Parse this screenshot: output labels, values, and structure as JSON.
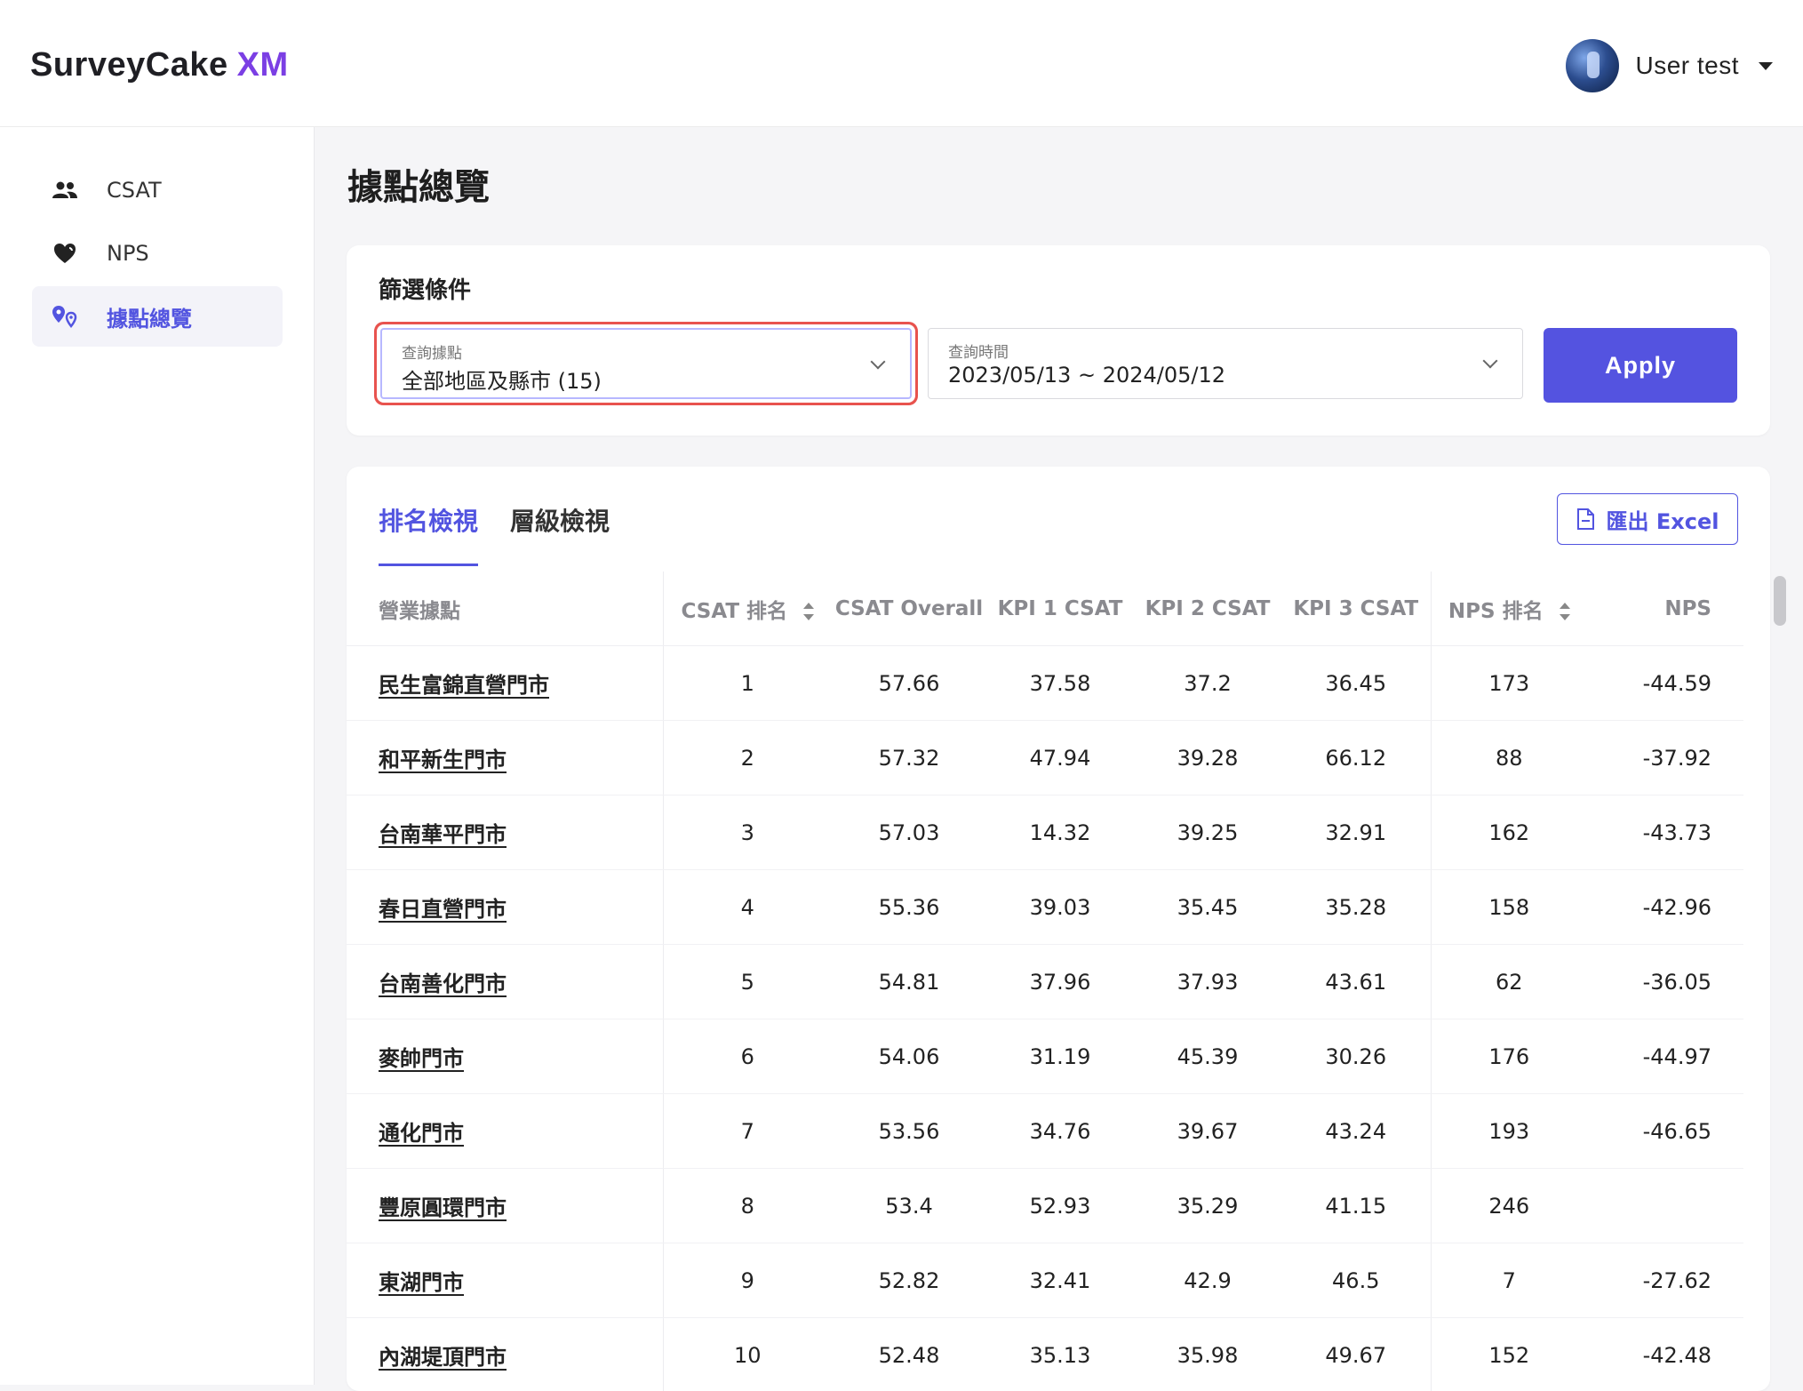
{
  "app": {
    "logo_main": "SurveyCake",
    "logo_suffix": "XM",
    "user_name": "User test"
  },
  "sidebar": {
    "items": [
      {
        "label": "CSAT",
        "icon": "people-icon",
        "active": false
      },
      {
        "label": "NPS",
        "icon": "heart-icon",
        "active": false
      },
      {
        "label": "據點總覽",
        "icon": "location-pin-icon",
        "active": true
      }
    ]
  },
  "page": {
    "title": "據點總覽"
  },
  "filters": {
    "title": "篩選條件",
    "location": {
      "label": "查詢據點",
      "value": "全部地區及縣市 (15)"
    },
    "period": {
      "label": "查詢時間",
      "value": "2023/05/13 ~ 2024/05/12"
    },
    "apply_label": "Apply"
  },
  "tabs": [
    {
      "label": "排名檢視",
      "active": true
    },
    {
      "label": "層級檢視",
      "active": false
    }
  ],
  "export_label": "匯出 Excel",
  "table": {
    "headers": {
      "name": "營業據點",
      "csat_rank": "CSAT 排名",
      "csat_overall": "CSAT Overall",
      "kpi1": "KPI 1 CSAT",
      "kpi2": "KPI 2 CSAT",
      "kpi3": "KPI 3 CSAT",
      "nps_rank": "NPS 排名",
      "nps": "NPS"
    },
    "rows": [
      {
        "name": "民生富錦直營門市",
        "csat_rank": "1",
        "csat_overall": "57.66",
        "kpi1": "37.58",
        "kpi2": "37.2",
        "kpi3": "36.45",
        "nps_rank": "173",
        "nps": "-44.59"
      },
      {
        "name": "和平新生門市",
        "csat_rank": "2",
        "csat_overall": "57.32",
        "kpi1": "47.94",
        "kpi2": "39.28",
        "kpi3": "66.12",
        "nps_rank": "88",
        "nps": "-37.92"
      },
      {
        "name": "台南華平門市",
        "csat_rank": "3",
        "csat_overall": "57.03",
        "kpi1": "14.32",
        "kpi2": "39.25",
        "kpi3": "32.91",
        "nps_rank": "162",
        "nps": "-43.73"
      },
      {
        "name": "春日直營門市",
        "csat_rank": "4",
        "csat_overall": "55.36",
        "kpi1": "39.03",
        "kpi2": "35.45",
        "kpi3": "35.28",
        "nps_rank": "158",
        "nps": "-42.96"
      },
      {
        "name": "台南善化門市",
        "csat_rank": "5",
        "csat_overall": "54.81",
        "kpi1": "37.96",
        "kpi2": "37.93",
        "kpi3": "43.61",
        "nps_rank": "62",
        "nps": "-36.05"
      },
      {
        "name": "麥帥門市",
        "csat_rank": "6",
        "csat_overall": "54.06",
        "kpi1": "31.19",
        "kpi2": "45.39",
        "kpi3": "30.26",
        "nps_rank": "176",
        "nps": "-44.97"
      },
      {
        "name": "通化門市",
        "csat_rank": "7",
        "csat_overall": "53.56",
        "kpi1": "34.76",
        "kpi2": "39.67",
        "kpi3": "43.24",
        "nps_rank": "193",
        "nps": "-46.65"
      },
      {
        "name": "豐原圓環門市",
        "csat_rank": "8",
        "csat_overall": "53.4",
        "kpi1": "52.93",
        "kpi2": "35.29",
        "kpi3": "41.15",
        "nps_rank": "246",
        "nps": ""
      },
      {
        "name": "東湖門市",
        "csat_rank": "9",
        "csat_overall": "52.82",
        "kpi1": "32.41",
        "kpi2": "42.9",
        "kpi3": "46.5",
        "nps_rank": "7",
        "nps": "-27.62"
      },
      {
        "name": "內湖堤頂門市",
        "csat_rank": "10",
        "csat_overall": "52.48",
        "kpi1": "35.13",
        "kpi2": "35.98",
        "kpi3": "49.67",
        "nps_rank": "152",
        "nps": "-42.48"
      }
    ]
  },
  "colors": {
    "accent": "#5254e0",
    "logo_suffix": "#7b3fe4",
    "highlight_outline": "#e8534e"
  }
}
